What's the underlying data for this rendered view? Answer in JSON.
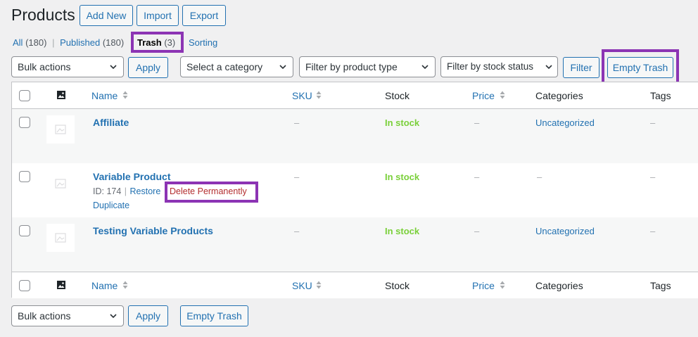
{
  "page": {
    "title": "Products"
  },
  "header_buttons": {
    "add_new": "Add New",
    "import": "Import",
    "export": "Export"
  },
  "views": {
    "all_label": "All",
    "all_count": "(180)",
    "sep": "|",
    "published_label": "Published",
    "published_count": "(180)",
    "trash_label": "Trash",
    "trash_count": "(3)",
    "sorting_label": "Sorting"
  },
  "toolbar": {
    "bulk_actions": "Bulk actions",
    "apply": "Apply",
    "category": "Select a category",
    "product_type": "Filter by product type",
    "stock_status": "Filter by stock status",
    "filter": "Filter",
    "empty_trash": "Empty Trash"
  },
  "columns": {
    "name": "Name",
    "sku": "SKU",
    "stock": "Stock",
    "price": "Price",
    "categories": "Categories",
    "tags": "Tags"
  },
  "rows": [
    {
      "name": "Affiliate",
      "sku": "–",
      "stock": "In stock",
      "price": "–",
      "categories": "Uncategorized",
      "tags": "–"
    },
    {
      "name": "Variable Product",
      "sku": "–",
      "stock": "In stock",
      "price": "–",
      "categories": "–",
      "tags": "–",
      "row_actions": {
        "id": "ID: 174",
        "sep": "|",
        "restore": "Restore",
        "delete": "Delete Permanently",
        "duplicate": "Duplicate"
      }
    },
    {
      "name": "Testing Variable Products",
      "sku": "–",
      "stock": "In stock",
      "price": "–",
      "categories": "Uncategorized",
      "tags": "–"
    }
  ],
  "bottom_toolbar": {
    "bulk_actions": "Bulk actions",
    "apply": "Apply",
    "empty_trash": "Empty Trash"
  },
  "colors": {
    "link": "#2271b1",
    "in_stock": "#7ad03a",
    "delete": "#b32d2e",
    "highlight": "#8c34b4"
  }
}
